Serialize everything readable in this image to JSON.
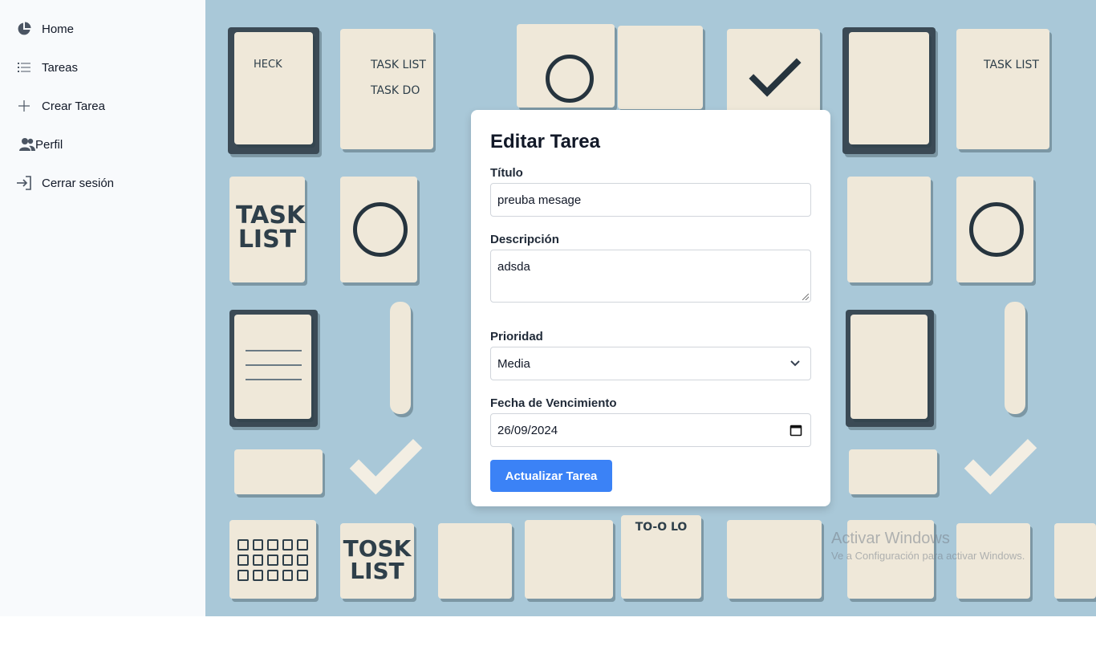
{
  "sidebar": {
    "items": [
      {
        "label": "Home",
        "icon": "pie-chart-icon"
      },
      {
        "label": "Tareas",
        "icon": "list-icon"
      },
      {
        "label": "Crear Tarea",
        "icon": "plus-icon"
      },
      {
        "label": "Perfil",
        "icon": "users-icon"
      },
      {
        "label": "Cerrar sesión",
        "icon": "sign-out-icon"
      }
    ]
  },
  "background": {
    "tiles": [
      "HECK",
      "TASK LIST",
      "TASK DO",
      "TASK LIST",
      "TASK LIST",
      "TOSK LIST",
      "TO-O LO"
    ]
  },
  "form": {
    "title": "Editar Tarea",
    "titulo_label": "Título",
    "titulo_value": "preuba mesage",
    "descripcion_label": "Descripción",
    "descripcion_value": "adsda",
    "prioridad_label": "Prioridad",
    "prioridad_value": "Media",
    "fecha_label": "Fecha de Vencimiento",
    "fecha_value": "26/09/2024",
    "submit_label": "Actualizar Tarea"
  },
  "watermark": {
    "line1": "Activar Windows",
    "line2": "Ve a Configuración para activar Windows."
  },
  "colors": {
    "accent": "#3b82f6",
    "sidebar_bg": "#f8fafc",
    "background": "#a9c8d8"
  }
}
